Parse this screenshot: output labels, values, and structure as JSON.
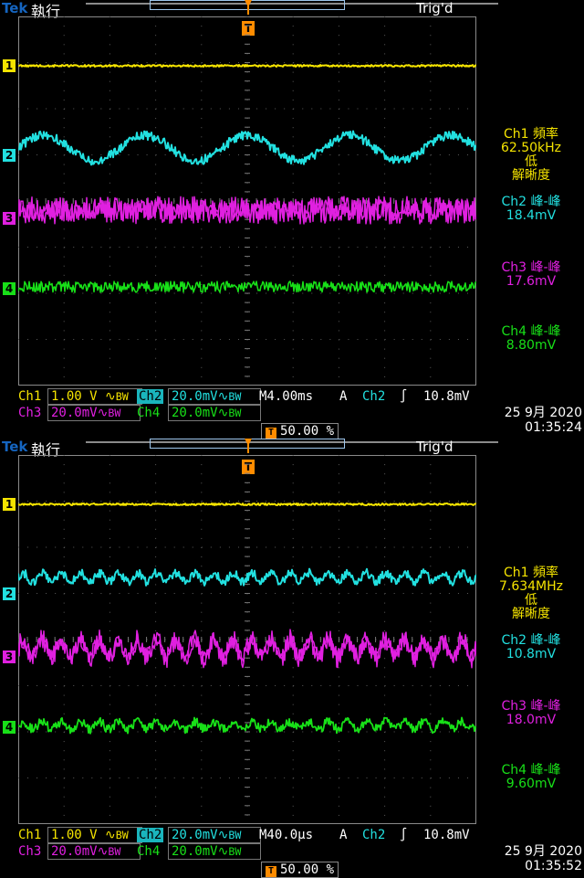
{
  "colors": {
    "ch1": "#f5e400",
    "ch2": "#22e0e0",
    "ch3": "#e020e0",
    "ch4": "#18e018",
    "trigger": "#ff8c00",
    "grid": "#5b5b5b"
  },
  "screens": [
    {
      "brand": "Tek",
      "mode": "執行",
      "trig_status": "Trig'd",
      "trig_marker": "T",
      "channel_markers": [
        "1",
        "2",
        "3",
        "4"
      ],
      "measurements": [
        {
          "label": "Ch1 頻率",
          "value": "62.50kHz",
          "extra1": "低",
          "extra2": "解晰度"
        },
        {
          "label": "Ch2 峰-峰",
          "value": "18.4mV"
        },
        {
          "label": "Ch3 峰-峰",
          "value": "17.6mV"
        },
        {
          "label": "Ch4 峰-峰",
          "value": "8.80mV"
        }
      ],
      "ch1_label": "Ch1",
      "ch1_scale": "1.00 V",
      "ch2_label": "Ch2",
      "ch2_scale": "20.0mV",
      "ch3_label": "Ch3",
      "ch3_scale": "20.0mV",
      "ch4_label": "Ch4",
      "ch4_scale": "20.0mV",
      "timebase": "M4.00ms",
      "trig_mode": "A",
      "trig_source": "Ch2",
      "trig_level": "10.8mV",
      "trig_position": "50.00 %",
      "date": "25 9月  2020",
      "time": "01:35:24"
    },
    {
      "brand": "Tek",
      "mode": "執行",
      "trig_status": "Trig'd",
      "trig_marker": "T",
      "channel_markers": [
        "1",
        "2",
        "3",
        "4"
      ],
      "measurements": [
        {
          "label": "Ch1 頻率",
          "value": "7.634MHz",
          "extra1": "低",
          "extra2": "解晰度"
        },
        {
          "label": "Ch2 峰-峰",
          "value": "10.8mV"
        },
        {
          "label": "Ch3 峰-峰",
          "value": "18.0mV"
        },
        {
          "label": "Ch4 峰-峰",
          "value": "9.60mV"
        }
      ],
      "ch1_label": "Ch1",
      "ch1_scale": "1.00 V",
      "ch2_label": "Ch2",
      "ch2_scale": "20.0mV",
      "ch3_label": "Ch3",
      "ch3_scale": "20.0mV",
      "ch4_label": "Ch4",
      "ch4_scale": "20.0mV",
      "timebase": "M40.0µs",
      "trig_mode": "A",
      "trig_source": "Ch2",
      "trig_level": "10.8mV",
      "trig_position": "50.00 %",
      "date": "25 9月  2020",
      "time": "01:35:52"
    }
  ]
}
